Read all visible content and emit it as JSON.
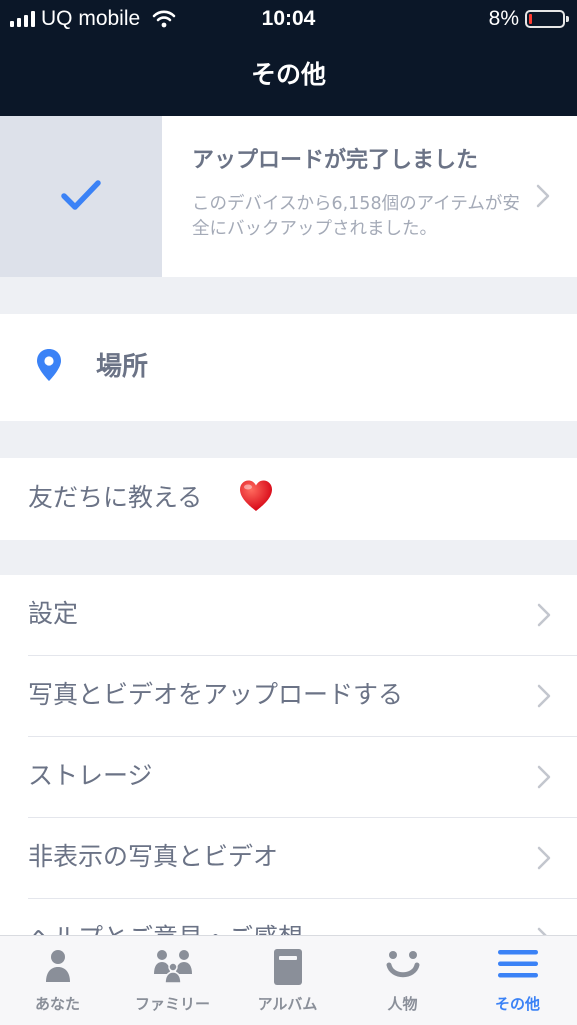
{
  "status_bar": {
    "carrier": "UQ mobile",
    "time": "10:04",
    "battery_percent": "8%",
    "battery_level": 0.08
  },
  "header": {
    "title": "その他"
  },
  "upload_status": {
    "title": "アップロードが完了しました",
    "subtitle": "このデバイスから6,158個のアイテムが安全にバックアップされました。"
  },
  "place": {
    "label": "場所"
  },
  "share": {
    "label": "友だちに教える",
    "emoji": "heart-emoji"
  },
  "menu": {
    "items": [
      {
        "label": "設定"
      },
      {
        "label": "写真とビデオをアップロードする"
      },
      {
        "label": "ストレージ"
      },
      {
        "label": "非表示の写真とビデオ"
      },
      {
        "label": "ヘルプとご意見・ご感想"
      }
    ]
  },
  "tabs": [
    {
      "label": "あなた",
      "icon": "person-icon",
      "active": false
    },
    {
      "label": "ファミリー",
      "icon": "family-icon",
      "active": false
    },
    {
      "label": "アルバム",
      "icon": "album-icon",
      "active": false
    },
    {
      "label": "人物",
      "icon": "smile-icon",
      "active": false
    },
    {
      "label": "その他",
      "icon": "menu-icon",
      "active": true
    }
  ],
  "colors": {
    "navbar": "#0b1728",
    "accent": "#3b82f6",
    "text": "#6b7386",
    "subtext": "#a4aab7"
  }
}
